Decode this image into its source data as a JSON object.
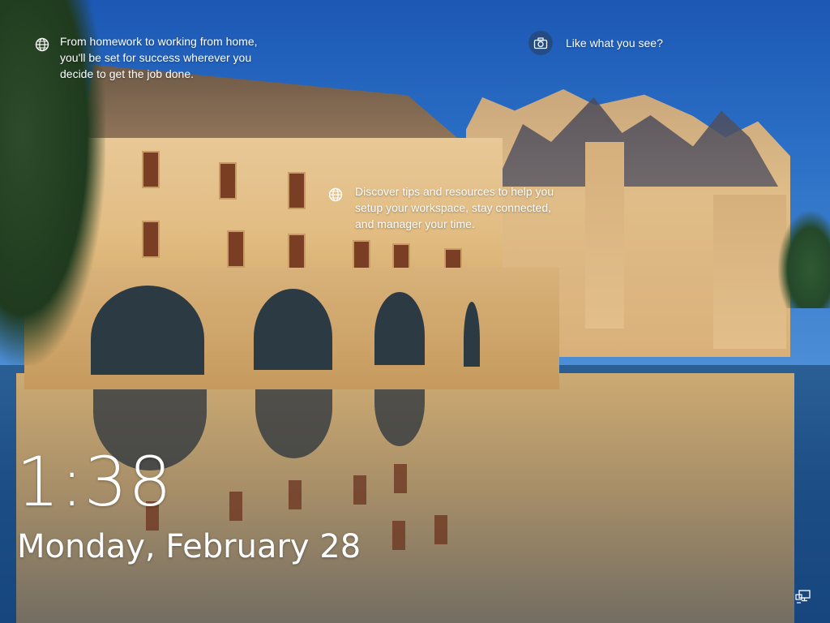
{
  "lockscreen": {
    "hotspot_homework": {
      "icon": "globe-icon",
      "text": "From homework to working from home,\nyou'll be set for success wherever you\ndecide to get the job done."
    },
    "hotspot_like": {
      "icon": "camera-icon",
      "text": "Like what you see?"
    },
    "hotspot_tips": {
      "icon": "globe-icon",
      "text": "Discover tips and resources to help you\nsetup your workspace, stay connected,\nand manager your time."
    },
    "time": "1:38",
    "date": "Monday, February 28",
    "network_icon": "network-monitor-icon"
  },
  "colors": {
    "sky": "#2b6fc6",
    "water": "#1c4d84",
    "stone": "#e2bd83",
    "text": "#ffffff"
  }
}
